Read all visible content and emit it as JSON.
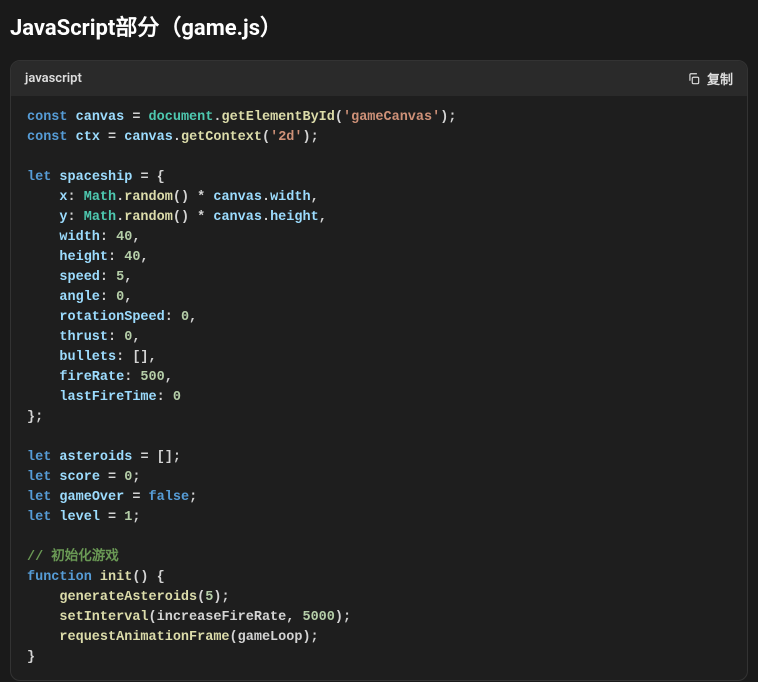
{
  "heading": "JavaScript部分（game.js）",
  "codebar": {
    "lang": "javascript",
    "copy": "复制"
  },
  "code": {
    "l01": {
      "a": "const",
      "b": "canvas",
      "c": " = ",
      "d": "document",
      "e": ".",
      "f": "getElementById",
      "g": "(",
      "h": "'gameCanvas'",
      "i": ");"
    },
    "l02": {
      "a": "const",
      "b": "ctx",
      "c": " = ",
      "d": "canvas",
      "e": ".",
      "f": "getContext",
      "g": "(",
      "h": "'2d'",
      "i": ");"
    },
    "l03": {
      "a": "let",
      "b": "spaceship",
      "c": " = {"
    },
    "l04": {
      "a": "x",
      "b": ": ",
      "c": "Math",
      "d": ".",
      "e": "random",
      "f": "() * ",
      "g": "canvas",
      "h": ".",
      "i": "width",
      "j": ","
    },
    "l05": {
      "a": "y",
      "b": ": ",
      "c": "Math",
      "d": ".",
      "e": "random",
      "f": "() * ",
      "g": "canvas",
      "h": ".",
      "i": "height",
      "j": ","
    },
    "l06": {
      "a": "width",
      "b": ": ",
      "c": "40",
      "d": ","
    },
    "l07": {
      "a": "height",
      "b": ": ",
      "c": "40",
      "d": ","
    },
    "l08": {
      "a": "speed",
      "b": ": ",
      "c": "5",
      "d": ","
    },
    "l09": {
      "a": "angle",
      "b": ": ",
      "c": "0",
      "d": ","
    },
    "l10": {
      "a": "rotationSpeed",
      "b": ": ",
      "c": "0",
      "d": ","
    },
    "l11": {
      "a": "thrust",
      "b": ": ",
      "c": "0",
      "d": ","
    },
    "l12": {
      "a": "bullets",
      "b": ": [],"
    },
    "l13": {
      "a": "fireRate",
      "b": ": ",
      "c": "500",
      "d": ","
    },
    "l14": {
      "a": "lastFireTime",
      "b": ": ",
      "c": "0"
    },
    "l15": {
      "a": "};"
    },
    "l16": {
      "a": "let",
      "b": "asteroids",
      "c": " = [];"
    },
    "l17": {
      "a": "let",
      "b": "score",
      "c": " = ",
      "d": "0",
      "e": ";"
    },
    "l18": {
      "a": "let",
      "b": "gameOver",
      "c": " = ",
      "d": "false",
      "e": ";"
    },
    "l19": {
      "a": "let",
      "b": "level",
      "c": " = ",
      "d": "1",
      "e": ";"
    },
    "l20": {
      "a": "// 初始化游戏"
    },
    "l21": {
      "a": "function",
      "b": "init",
      "c": "() {"
    },
    "l22": {
      "a": "generateAsteroids",
      "b": "(",
      "c": "5",
      "d": ");"
    },
    "l23": {
      "a": "setInterval",
      "b": "(increaseFireRate, ",
      "c": "5000",
      "d": ");"
    },
    "l24": {
      "a": "requestAnimationFrame",
      "b": "(gameLoop);"
    },
    "l25": {
      "a": "}"
    }
  }
}
